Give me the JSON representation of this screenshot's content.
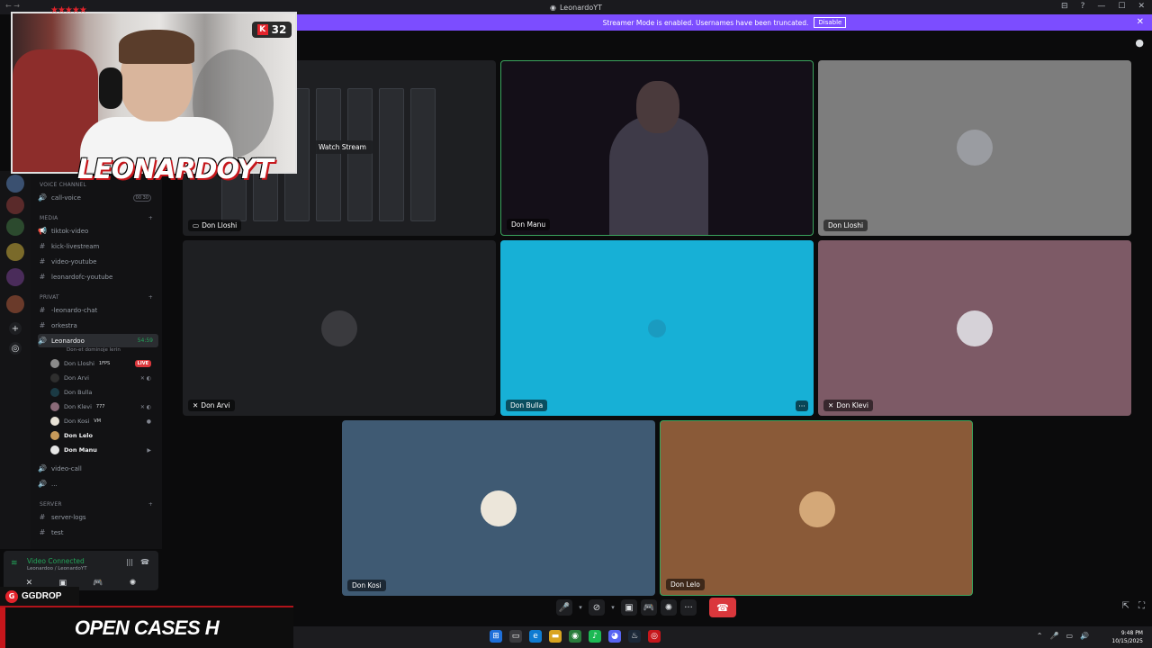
{
  "window": {
    "title": "LeonardoYT",
    "nav_arrows": "← →",
    "controls": [
      "⊟",
      "?",
      "—",
      "☐",
      "✕"
    ]
  },
  "banner": {
    "message": "Streamer Mode is enabled. Usernames have been truncated.",
    "disable_label": "Disable",
    "close": "✕"
  },
  "overlay": {
    "viewer_count": "32",
    "viewer_icon": "K",
    "streamer_name": "LEONARDOYT",
    "stars": "★★★★★"
  },
  "sidebar": {
    "voice_category": "Voice Channel",
    "call_voice": "call-voice",
    "call_voice_badge": "00 30",
    "media_category": "MEDIA",
    "media_channels": [
      "tiktok-video",
      "kick-livestream",
      "video-youtube",
      "leonardofc-youtube"
    ],
    "privat_category": "PRIVAT",
    "privat_channels": [
      "-leonardo-chat",
      "orkestra"
    ],
    "active_voice": {
      "name": "Leonardoo",
      "time": "54:59",
      "status": "Don-et dominoje lerin"
    },
    "members": [
      {
        "name": "Don Lloshi",
        "tag": "1FPS",
        "live": "LIVE"
      },
      {
        "name": "Don Arvi",
        "tag": ""
      },
      {
        "name": "Don Bulla",
        "tag": ""
      },
      {
        "name": "Don Klevi",
        "tag": "777"
      },
      {
        "name": "Don Kosi",
        "tag": "VM"
      },
      {
        "name": "Don Lelo",
        "tag": ""
      },
      {
        "name": "Don Manu",
        "tag": ""
      }
    ],
    "video_call": "video-call",
    "dots_channel": "...",
    "server_category": "server",
    "server_channels": [
      "server-logs",
      "test"
    ]
  },
  "voice_panel": {
    "title": "Video Connected",
    "subtitle": "Leonardoo / LeonardoYT"
  },
  "tiles": [
    {
      "name": "Don Lloshi",
      "watch_label": "Watch Stream"
    },
    {
      "name": "Don Manu"
    },
    {
      "name": "Don Lloshi"
    },
    {
      "name": "Don Arvi"
    },
    {
      "name": "Don Bulla",
      "more": "···"
    },
    {
      "name": "Don Klevi"
    },
    {
      "name": "Don Kosi"
    },
    {
      "name": "Don Lelo"
    }
  ],
  "promo": {
    "brand": "GGDROP",
    "brand_logo": "G",
    "headline": "OPEN CASES H"
  },
  "taskbar": {
    "time": "9:48 PM",
    "date": "10/15/2025"
  },
  "colors": {
    "accent": "#7c4dff",
    "online": "#23a55a",
    "danger": "#da373c",
    "tile_bulla": "#17b0d6",
    "tile_klevi": "#7d5a66",
    "tile_kosi": "#3f5a73",
    "tile_lelo": "#8a5a38",
    "tile_lloshi_gray": "#7d7d7d"
  }
}
